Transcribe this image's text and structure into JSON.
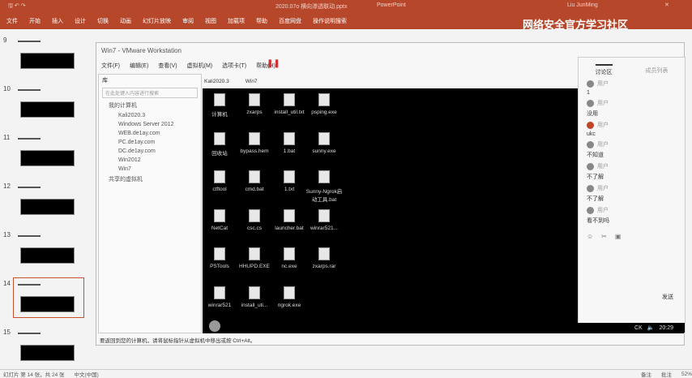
{
  "titlebar": {
    "file": "2020.07o 横向渗透联动.pptx",
    "app": "PowerPoint",
    "user": "Liu JunMing"
  },
  "ribbon": [
    "文件",
    "开始",
    "插入",
    "设计",
    "切换",
    "动画",
    "幻灯片放映",
    "审阅",
    "视图",
    "加载项",
    "帮助",
    "百度网盘",
    "操作说明搜索"
  ],
  "watermark": "网络安全官方学习社区",
  "slides": [
    "9",
    "10",
    "11",
    "12",
    "13",
    "14",
    "15"
  ],
  "vmware": {
    "title": "Win7 - VMware Workstation",
    "menu": [
      "文件(F)",
      "编辑(E)",
      "查看(V)",
      "虚拟机(M)",
      "选项卡(T)",
      "帮助(H)"
    ],
    "library": {
      "title": "库",
      "search": "在此处键入内容进行搜索",
      "root": "我的计算机",
      "vms": [
        "Kali2020.3",
        "Windows Server 2012",
        "WEB.de1ay.com",
        "PC.de1ay.com",
        "DC.de1ay.com",
        "Win2012",
        "Win7"
      ],
      "shared": "共享的虚拟机"
    },
    "tabs": [
      "Kali2020.3",
      "Win7"
    ],
    "statusbar": "要返回到您的计算机，请将鼠标指针从虚拟机中移出或按 Ctrl+Alt。"
  },
  "desktop": [
    [
      "计算机",
      "zxarps",
      "install_util.txt",
      "psping.exe"
    ],
    [
      "回收站",
      "bypass.hem",
      "1.bat",
      "sunny.exe"
    ],
    [
      "ctftool",
      "cmd.bat",
      "1.txt",
      "Sunny-Ngrok启动工具.bat"
    ],
    [
      "NetCat",
      "csc.cs",
      "launcher.bat",
      "winrar521..."
    ],
    [
      "PSTools",
      "HHUPD.EXE",
      "nc.exe",
      "zxarps.rar"
    ],
    [
      "winrar521",
      "install_uti...",
      "ngrok.exe"
    ]
  ],
  "chat": {
    "tabs": [
      "讨论区",
      "成员列表"
    ],
    "messages": [
      {
        "name": "用户",
        "text": "1"
      },
      {
        "name": "用户",
        "text": "没用"
      },
      {
        "name": "用户",
        "text": "ukc"
      },
      {
        "name": "用户",
        "text": "不知道"
      },
      {
        "name": "用户",
        "text": "不了解"
      },
      {
        "name": "用户",
        "text": "不了解"
      },
      {
        "name": "用户",
        "text": "看不到吗"
      }
    ],
    "send": "发送"
  },
  "taskbar": {
    "lang": "CK",
    "time": "20:29"
  },
  "status": [
    "幻灯片 第 14 张，共 24 张",
    "中文(中国)",
    "备注",
    "批注",
    "52%"
  ]
}
